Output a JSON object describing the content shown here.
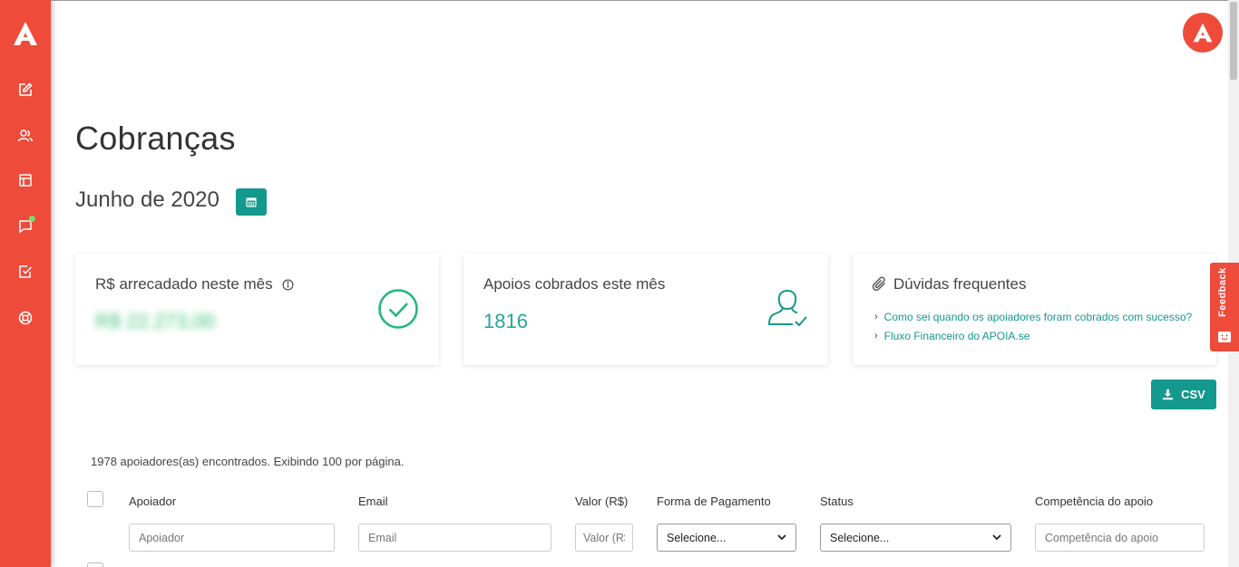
{
  "sidebar": {
    "logo_icon": "apoia-logo-icon",
    "items": [
      {
        "name": "edit",
        "icon": "edit-icon"
      },
      {
        "name": "users",
        "icon": "users-icon"
      },
      {
        "name": "layout",
        "icon": "layout-icon"
      },
      {
        "name": "messages",
        "icon": "chat-icon",
        "has_notification": true
      },
      {
        "name": "tasks",
        "icon": "checklist-icon"
      },
      {
        "name": "support",
        "icon": "lifebuoy-icon"
      }
    ]
  },
  "header": {
    "avatar_icon": "apoia-brand-icon"
  },
  "page": {
    "title": "Cobranças",
    "month": "Junho de 2020"
  },
  "cards": {
    "raised": {
      "label": "R$ arrecadado neste mês",
      "value": "R$ 22.273,00"
    },
    "supports": {
      "label": "Apoios cobrados este mês",
      "value": "1816"
    },
    "faq": {
      "title": "Dúvidas frequentes",
      "links": [
        "Como sei quando os apoiadores foram cobrados com sucesso?",
        "Fluxo Financeiro do APOIA.se"
      ]
    }
  },
  "feedback": {
    "label": "Feedback"
  },
  "toolbar": {
    "csv_label": "CSV"
  },
  "table": {
    "summary": "1978 apoiadores(as) encontrados. Exibindo 100 por página.",
    "columns": {
      "supporter": "Apoiador",
      "email": "Email",
      "value": "Valor (R$)",
      "payment": "Forma de Pagamento",
      "status": "Status",
      "period": "Competência do apoio"
    },
    "filters": {
      "supporter_placeholder": "Apoiador",
      "email_placeholder": "Email",
      "value_placeholder": "Valor (R$)",
      "payment_selected": "Selecione...",
      "status_selected": "Selecione...",
      "period_placeholder": "Competência do apoio"
    }
  },
  "colors": {
    "brand": "#ef4b3a",
    "accent": "#14998e",
    "success": "#26a69a"
  }
}
